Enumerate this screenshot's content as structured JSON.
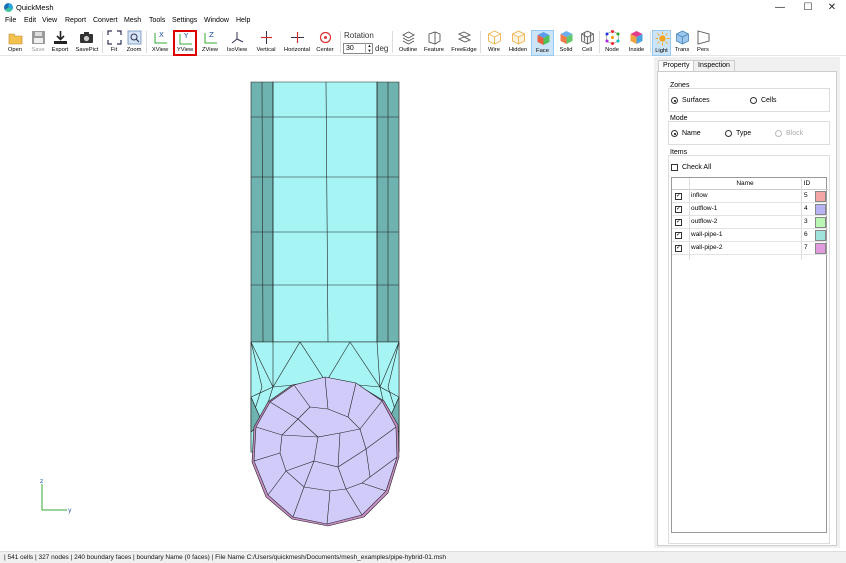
{
  "window": {
    "title": "QuickMesh",
    "minimize": "—",
    "maximize": "☐",
    "close": "✕"
  },
  "menu": [
    "File",
    "Edit",
    "View",
    "Report",
    "Convert",
    "Mesh",
    "Tools",
    "Settings",
    "Window",
    "Help"
  ],
  "toolbar": {
    "open": "Open",
    "save": "Save",
    "export": "Export",
    "savepict": "SavePict",
    "fit": "Fit",
    "zoom": "Zoom",
    "xview": "XView",
    "yview": "YView",
    "zview": "ZView",
    "isoview": "IsoView",
    "vertical": "Vertical",
    "horizontal": "Horizontal",
    "center": "Center",
    "outline": "Outline",
    "feature": "Feature",
    "freeedge": "FreeEdge",
    "wire": "Wire",
    "hidden": "Hidden",
    "face": "Face",
    "solid": "Solid",
    "cell": "Cell",
    "node": "Node",
    "inside": "Inside",
    "light": "Light",
    "trans": "Trans",
    "pers": "Pers"
  },
  "rotation": {
    "label": "Rotation",
    "value": "30",
    "unit": "deg"
  },
  "panel": {
    "tabs": [
      "Property",
      "Inspection"
    ],
    "zones": {
      "label": "Zones",
      "surfaces": "Surfaces",
      "cells": "Cells"
    },
    "mode": {
      "label": "Mode",
      "name": "Name",
      "type": "Type",
      "block": "Block"
    },
    "items": {
      "label": "Items",
      "checkall": "Check All",
      "col_name": "Name",
      "col_id": "ID",
      "rows": [
        {
          "name": "inflow",
          "id": "5",
          "color": "#f4a6a6"
        },
        {
          "name": "outflow-1",
          "id": "4",
          "color": "#b8b3f2"
        },
        {
          "name": "outflow-2",
          "id": "3",
          "color": "#b9f5b3"
        },
        {
          "name": "wall-pipe-1",
          "id": "6",
          "color": "#9fe3dc"
        },
        {
          "name": "wall-pipe-2",
          "id": "7",
          "color": "#e39be0"
        }
      ]
    }
  },
  "axes": {
    "z": "z",
    "y": "y"
  },
  "status": "| 541 cells | 327 nodes | 240 boundary faces |  boundary Name  (0 faces) | File Name C:/Users/quickmesh/Documents/mesh_examples/pipe-hybrid-01.msh",
  "colors": {
    "mesh_face": "#a6f4f4",
    "mesh_side": "#6fb3b0",
    "inlet_face": "#d1cbfa",
    "wall2": "#c68ec4",
    "axis": "#3aa53a",
    "highlight": "#e00000"
  }
}
